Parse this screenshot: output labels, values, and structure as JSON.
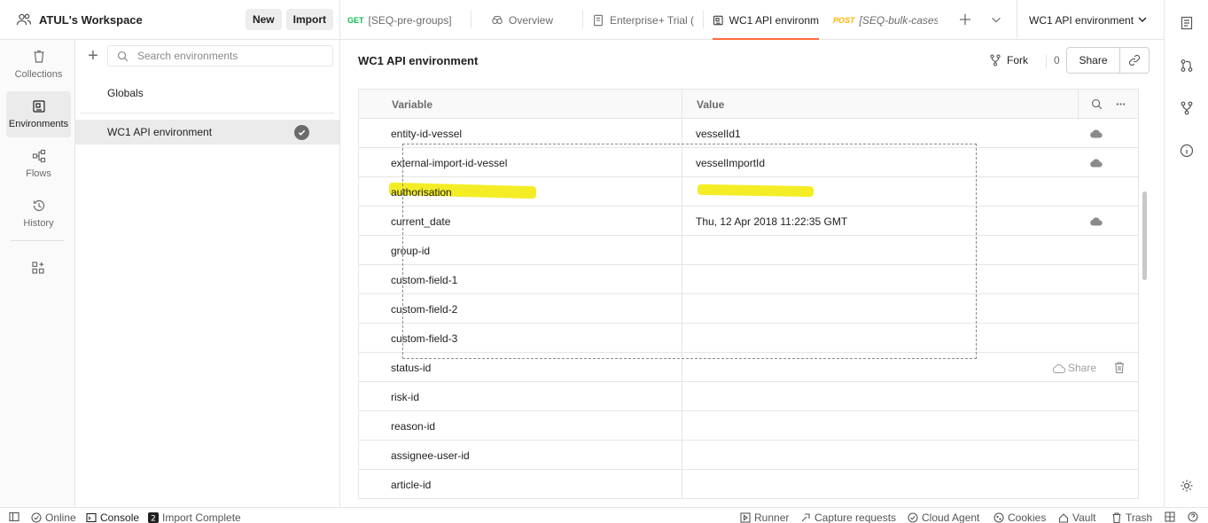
{
  "workspace": {
    "title": "ATUL's Workspace",
    "new_label": "New",
    "import_label": "Import"
  },
  "leftnav": {
    "items": [
      {
        "label": "Collections",
        "icon": "trash-can-like-collections-icon"
      },
      {
        "label": "Environments",
        "icon": "environments-icon"
      },
      {
        "label": "Flows",
        "icon": "flows-icon"
      },
      {
        "label": "History",
        "icon": "history-icon"
      }
    ]
  },
  "envlist": {
    "search_placeholder": "Search environments",
    "globals_label": "Globals",
    "active_env": "WC1 API environment"
  },
  "tabs": [
    {
      "method": "GET",
      "label": "[SEQ-pre-groups]"
    },
    {
      "label": "Overview"
    },
    {
      "label": "Enterprise+ Trial ("
    },
    {
      "label": "WC1 API environm"
    },
    {
      "method": "POST",
      "label": "[SEQ-bulk-cases"
    }
  ],
  "env_selector": "WC1 API environment",
  "main": {
    "env_name": "WC1 API environment",
    "fork_label": "Fork",
    "fork_count": "0",
    "share_label": "Share",
    "columns": {
      "variable": "Variable",
      "value": "Value"
    },
    "rows": [
      {
        "variable": "entity-id-vessel",
        "value": "vesselId1"
      },
      {
        "variable": "external-import-id-vessel",
        "value": "vesselImportId"
      },
      {
        "variable": "authorisation",
        "value": ""
      },
      {
        "variable": "current_date",
        "value": "Thu, 12 Apr 2018 11:22:35 GMT"
      },
      {
        "variable": "group-id",
        "value": ""
      },
      {
        "variable": "custom-field-1",
        "value": ""
      },
      {
        "variable": "custom-field-2",
        "value": ""
      },
      {
        "variable": "custom-field-3",
        "value": ""
      },
      {
        "variable": "status-id",
        "value": ""
      },
      {
        "variable": "risk-id",
        "value": ""
      },
      {
        "variable": "reason-id",
        "value": ""
      },
      {
        "variable": "assignee-user-id",
        "value": ""
      },
      {
        "variable": "article-id",
        "value": ""
      }
    ],
    "row_share_label": "Share"
  },
  "statusbar": {
    "online": "Online",
    "console": "Console",
    "import_complete": "Import Complete",
    "runner": "Runner",
    "capture": "Capture requests",
    "cloud_agent": "Cloud Agent",
    "cookies": "Cookies",
    "vault": "Vault",
    "trash": "Trash"
  },
  "colors": {
    "accent": "#ff6c37",
    "highlight": "#f2ea00",
    "get": "#0cbb52",
    "post": "#ffb400"
  }
}
